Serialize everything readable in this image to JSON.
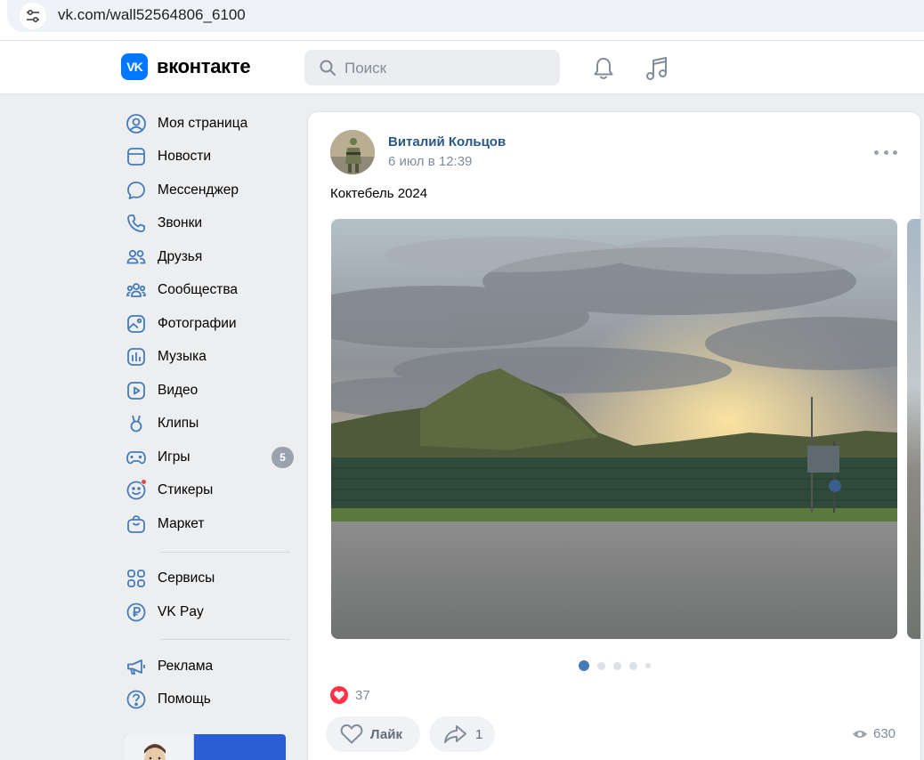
{
  "browser": {
    "url": "vk.com/wall52564806_6100",
    "icons": {
      "site_settings": "tune-icon"
    }
  },
  "header": {
    "logo_mark": "VK",
    "logo_text": "вконтакте",
    "search_placeholder": "Поиск",
    "icons": [
      "search-icon",
      "bell-icon",
      "music-note-icon"
    ],
    "accent_color": "#0077ff"
  },
  "sidebar": {
    "items": [
      {
        "label": "Моя страница",
        "icon": "user-circle-icon"
      },
      {
        "label": "Новости",
        "icon": "news-icon"
      },
      {
        "label": "Мессенджер",
        "icon": "chat-bubble-icon"
      },
      {
        "label": "Звонки",
        "icon": "phone-icon"
      },
      {
        "label": "Друзья",
        "icon": "friends-icon"
      },
      {
        "label": "Сообщества",
        "icon": "communities-icon"
      },
      {
        "label": "Фотографии",
        "icon": "photo-icon"
      },
      {
        "label": "Музыка",
        "icon": "music-icon"
      },
      {
        "label": "Видео",
        "icon": "video-icon"
      },
      {
        "label": "Клипы",
        "icon": "clips-icon"
      },
      {
        "label": "Игры",
        "icon": "gamepad-icon",
        "badge": "5"
      },
      {
        "label": "Стикеры",
        "icon": "smile-icon",
        "dot": true
      },
      {
        "label": "Маркет",
        "icon": "bag-icon"
      }
    ],
    "items2": [
      {
        "label": "Сервисы",
        "icon": "grid-icon"
      },
      {
        "label": "VK Pay",
        "icon": "ruble-icon"
      }
    ],
    "items3": [
      {
        "label": "Реклама",
        "icon": "megaphone-icon"
      },
      {
        "label": "Помощь",
        "icon": "help-icon"
      }
    ]
  },
  "post": {
    "author": "Виталий Кольцов",
    "date": "6 июл в 12:39",
    "text": "Коктебель 2024",
    "carousel": {
      "total": 5,
      "active": 1
    },
    "likes": "37",
    "like_label": "Лайк",
    "shares": "1",
    "views": "630",
    "icons": [
      "more-icon",
      "heart-icon",
      "share-icon",
      "eye-icon"
    ],
    "like_color": "#ff3347",
    "link_color": "#2a5885"
  }
}
